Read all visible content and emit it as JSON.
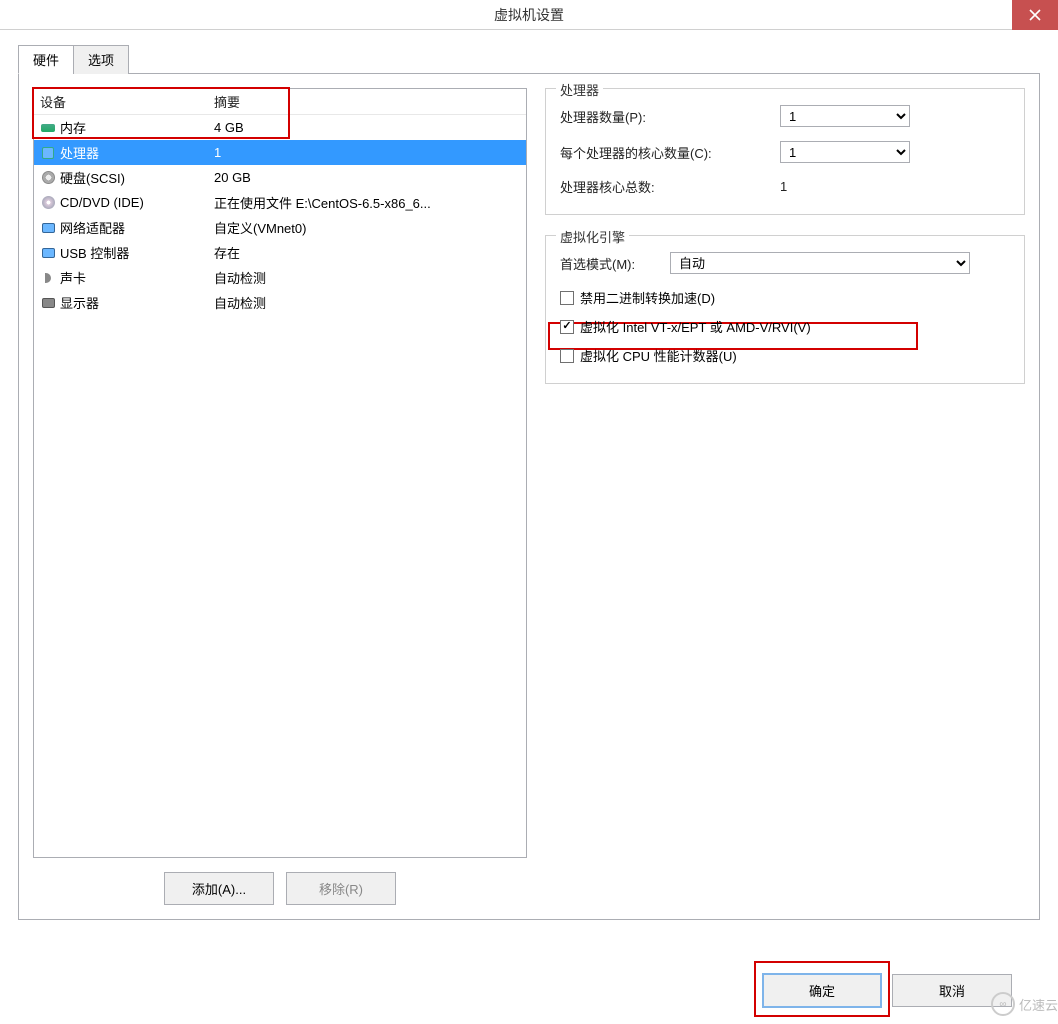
{
  "window": {
    "title": "虚拟机设置"
  },
  "tabs": {
    "hardware": "硬件",
    "options": "选项"
  },
  "list": {
    "header_device": "设备",
    "header_summary": "摘要",
    "rows": [
      {
        "icon": "memory-icon",
        "name": "内存",
        "summary": "4 GB"
      },
      {
        "icon": "cpu-icon",
        "name": "处理器",
        "summary": "1"
      },
      {
        "icon": "disk-icon",
        "name": "硬盘(SCSI)",
        "summary": "20 GB"
      },
      {
        "icon": "cd-icon",
        "name": "CD/DVD (IDE)",
        "summary": "正在使用文件 E:\\CentOS-6.5-x86_6..."
      },
      {
        "icon": "network-icon",
        "name": "网络适配器",
        "summary": "自定义(VMnet0)"
      },
      {
        "icon": "usb-icon",
        "name": "USB 控制器",
        "summary": "存在"
      },
      {
        "icon": "sound-icon",
        "name": "声卡",
        "summary": "自动检测"
      },
      {
        "icon": "display-icon",
        "name": "显示器",
        "summary": "自动检测"
      }
    ],
    "selected_index": 1
  },
  "left_buttons": {
    "add": "添加(A)...",
    "remove": "移除(R)"
  },
  "processor_group": {
    "title": "处理器",
    "count_label": "处理器数量(P):",
    "count_value": "1",
    "cores_label": "每个处理器的核心数量(C):",
    "cores_value": "1",
    "total_label": "处理器核心总数:",
    "total_value": "1"
  },
  "virt_group": {
    "title": "虚拟化引擎",
    "mode_label": "首选模式(M):",
    "mode_value": "自动",
    "disable_bt": "禁用二进制转换加速(D)",
    "vt_x": "虚拟化 Intel VT-x/EPT 或 AMD-V/RVI(V)",
    "cpu_perf": "虚拟化 CPU 性能计数器(U)",
    "checked": {
      "disable_bt": false,
      "vt_x": true,
      "cpu_perf": false
    }
  },
  "bottom": {
    "ok": "确定",
    "cancel": "取消"
  },
  "watermark": "亿速云"
}
